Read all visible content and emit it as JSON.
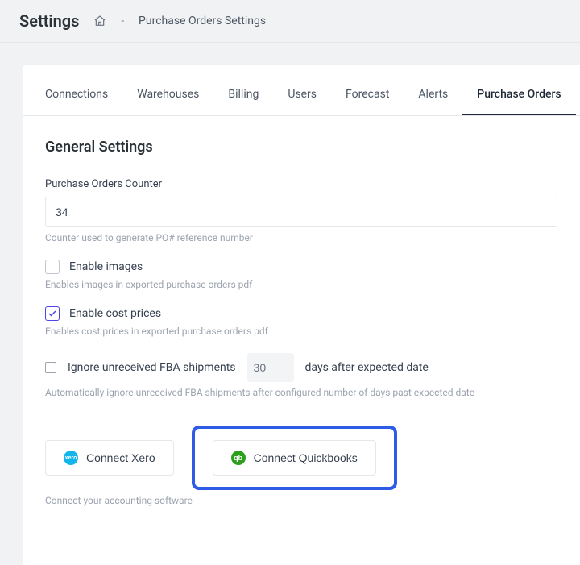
{
  "header": {
    "title": "Settings",
    "breadcrumb_sep": "-",
    "breadcrumb_current": "Purchase Orders Settings"
  },
  "tabs": [
    {
      "label": "Connections",
      "active": false
    },
    {
      "label": "Warehouses",
      "active": false
    },
    {
      "label": "Billing",
      "active": false
    },
    {
      "label": "Users",
      "active": false
    },
    {
      "label": "Forecast",
      "active": false
    },
    {
      "label": "Alerts",
      "active": false
    },
    {
      "label": "Purchase Orders",
      "active": true
    }
  ],
  "section": {
    "title": "General Settings",
    "counter_label": "Purchase Orders Counter",
    "counter_value": "34",
    "counter_helper": "Counter used to generate PO# reference number",
    "enable_images_label": "Enable images",
    "enable_images_checked": false,
    "enable_images_helper": "Enables images in exported purchase orders pdf",
    "enable_cost_label": "Enable cost prices",
    "enable_cost_checked": true,
    "enable_cost_helper": "Enables cost prices in exported purchase orders pdf",
    "ignore_fba_label_before": "Ignore unreceived FBA shipments",
    "ignore_fba_days": "30",
    "ignore_fba_label_after": "days after expected date",
    "ignore_fba_helper": "Automatically ignore unreceived FBA shipments after configured number of days past expected date",
    "connect_xero_label": "Connect Xero",
    "connect_qb_label": "Connect Quickbooks",
    "connect_helper": "Connect your accounting software",
    "xero_badge": "xero",
    "qb_badge": "qb"
  }
}
